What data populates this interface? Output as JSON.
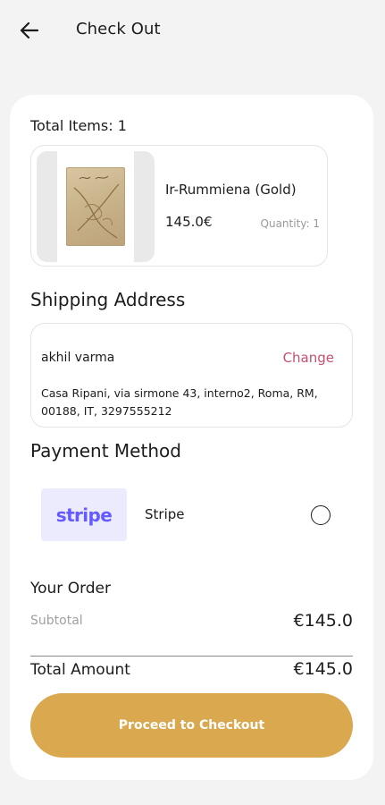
{
  "header": {
    "back_icon": "arrow-left-icon",
    "title": "Check Out"
  },
  "summary": {
    "total_items_label": "Total Items: 1"
  },
  "product": {
    "name": "Ir-Rummiena (Gold)",
    "price": "145.0€",
    "quantity": "Quantity: 1"
  },
  "shipping": {
    "title": "Shipping Address",
    "name": "akhil varma",
    "change_label": "Change",
    "address": "Casa Ripani, via sirmone 43, interno2, Roma, RM, 00188, IT, 3297555212"
  },
  "payment": {
    "title": "Payment Method",
    "logo_text": "stripe",
    "method_label": "Stripe",
    "selected": false
  },
  "order": {
    "title": "Your Order",
    "subtotal_label": "Subtotal",
    "subtotal_value": "€145.0",
    "total_label": "Total Amount",
    "total_value": "€145.0"
  },
  "cta": {
    "label": "Proceed to Checkout"
  },
  "colors": {
    "accent": "#d9a84f",
    "change_link": "#c2506f",
    "stripe_brand": "#635bff",
    "background": "#f3f3f3"
  }
}
